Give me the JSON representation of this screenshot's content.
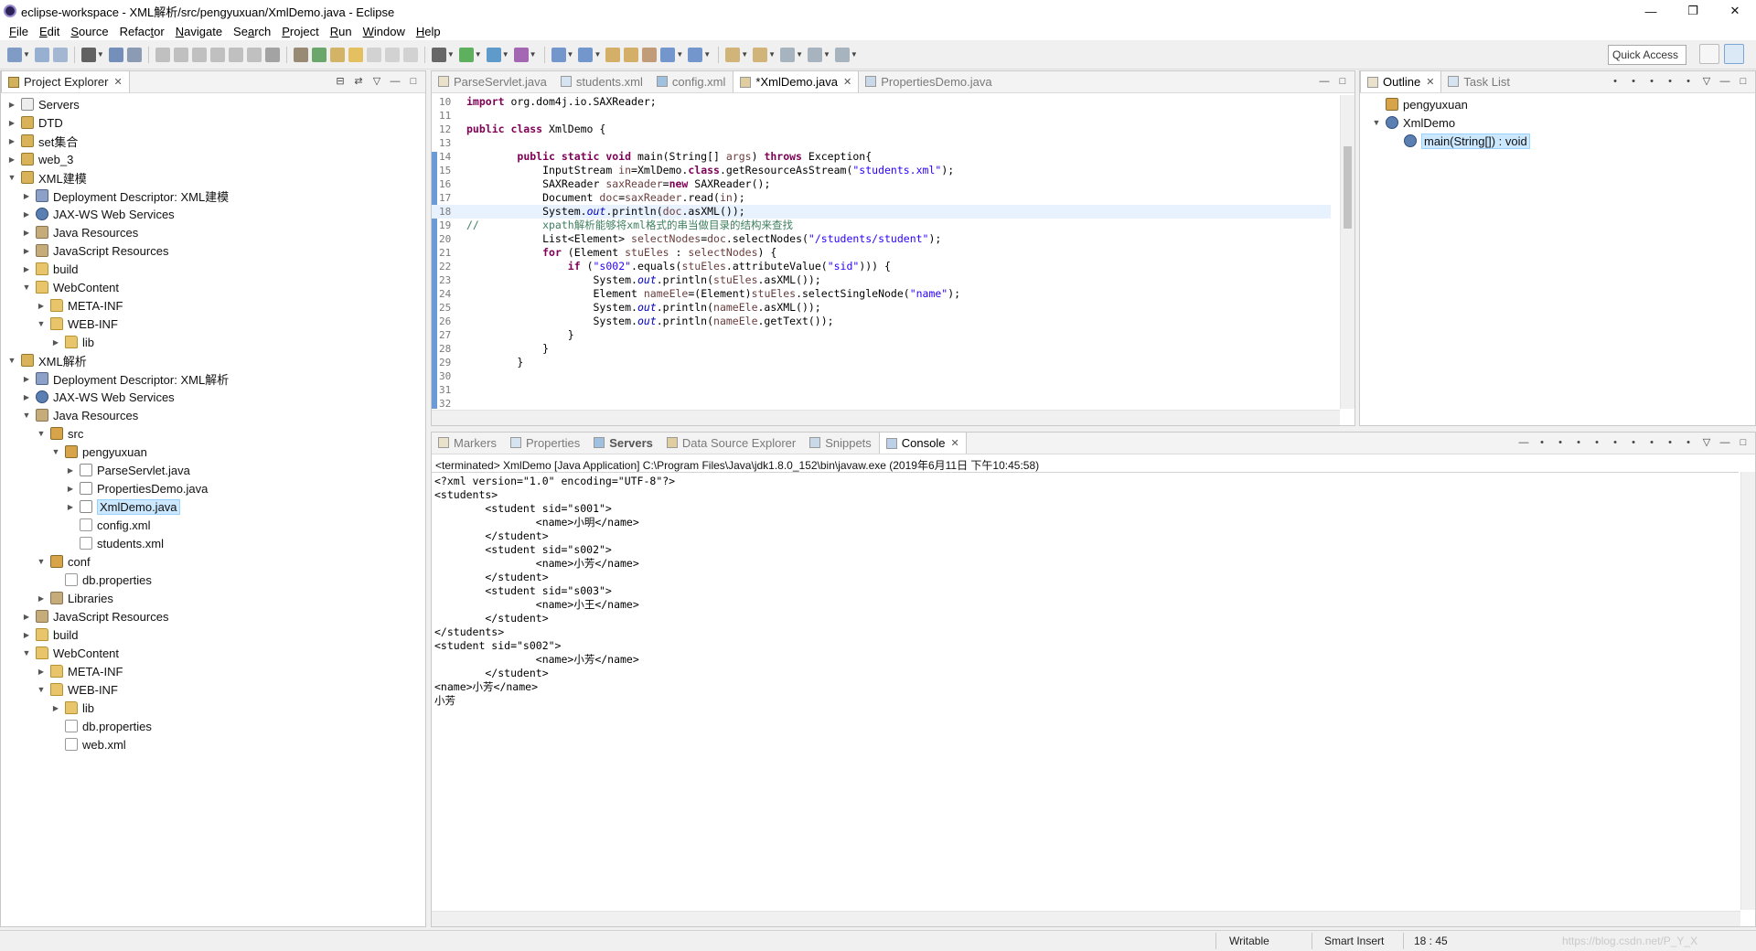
{
  "window": {
    "title": "eclipse-workspace - XML解析/src/pengyuxuan/XmlDemo.java - Eclipse"
  },
  "menu": [
    {
      "pre": "",
      "u": "F",
      "post": "ile"
    },
    {
      "pre": "",
      "u": "E",
      "post": "dit"
    },
    {
      "pre": "",
      "u": "S",
      "post": "ource"
    },
    {
      "pre": "Refac",
      "u": "t",
      "post": "or"
    },
    {
      "pre": "",
      "u": "N",
      "post": "avigate"
    },
    {
      "pre": "Se",
      "u": "a",
      "post": "rch"
    },
    {
      "pre": "",
      "u": "P",
      "post": "roject"
    },
    {
      "pre": "",
      "u": "R",
      "post": "un"
    },
    {
      "pre": "",
      "u": "W",
      "post": "indow"
    },
    {
      "pre": "",
      "u": "H",
      "post": "elp"
    }
  ],
  "toolbar": {
    "quick_access": "Quick Access"
  },
  "project_explorer": {
    "tab": "Project Explorer",
    "items": [
      {
        "label": "Servers",
        "depth": 0,
        "arrow": "right",
        "icon": "srv"
      },
      {
        "label": "DTD",
        "depth": 0,
        "arrow": "right",
        "icon": "proj"
      },
      {
        "label": "set集合",
        "depth": 0,
        "arrow": "right",
        "icon": "proj"
      },
      {
        "label": "web_3",
        "depth": 0,
        "arrow": "right",
        "icon": "proj"
      },
      {
        "label": "XML建模",
        "depth": 0,
        "arrow": "down",
        "icon": "proj"
      },
      {
        "label": "Deployment Descriptor: XML建模",
        "depth": 1,
        "arrow": "right",
        "icon": "dd"
      },
      {
        "label": "JAX-WS Web Services",
        "depth": 1,
        "arrow": "right",
        "icon": "ws"
      },
      {
        "label": "Java Resources",
        "depth": 1,
        "arrow": "right",
        "icon": "lib"
      },
      {
        "label": "JavaScript Resources",
        "depth": 1,
        "arrow": "right",
        "icon": "lib"
      },
      {
        "label": "build",
        "depth": 1,
        "arrow": "right",
        "icon": "folder"
      },
      {
        "label": "WebContent",
        "depth": 1,
        "arrow": "down",
        "icon": "folder"
      },
      {
        "label": "META-INF",
        "depth": 2,
        "arrow": "right",
        "icon": "folder"
      },
      {
        "label": "WEB-INF",
        "depth": 2,
        "arrow": "down",
        "icon": "folder"
      },
      {
        "label": "lib",
        "depth": 3,
        "arrow": "right",
        "icon": "folder"
      },
      {
        "label": "XML解析",
        "depth": 0,
        "arrow": "down",
        "icon": "proj"
      },
      {
        "label": "Deployment Descriptor: XML解析",
        "depth": 1,
        "arrow": "right",
        "icon": "dd"
      },
      {
        "label": "JAX-WS Web Services",
        "depth": 1,
        "arrow": "right",
        "icon": "ws"
      },
      {
        "label": "Java Resources",
        "depth": 1,
        "arrow": "down",
        "icon": "lib"
      },
      {
        "label": "src",
        "depth": 2,
        "arrow": "down",
        "icon": "pkg"
      },
      {
        "label": "pengyuxuan",
        "depth": 3,
        "arrow": "down",
        "icon": "pkg"
      },
      {
        "label": "ParseServlet.java",
        "depth": 4,
        "arrow": "right",
        "icon": "java"
      },
      {
        "label": "PropertiesDemo.java",
        "depth": 4,
        "arrow": "right",
        "icon": "java"
      },
      {
        "label": "XmlDemo.java",
        "depth": 4,
        "arrow": "right",
        "icon": "java",
        "selected": true
      },
      {
        "label": "config.xml",
        "depth": 4,
        "arrow": "",
        "icon": "xml"
      },
      {
        "label": "students.xml",
        "depth": 4,
        "arrow": "",
        "icon": "xml"
      },
      {
        "label": "conf",
        "depth": 2,
        "arrow": "down",
        "icon": "pkg"
      },
      {
        "label": "db.properties",
        "depth": 3,
        "arrow": "",
        "icon": "xml"
      },
      {
        "label": "Libraries",
        "depth": 2,
        "arrow": "right",
        "icon": "lib"
      },
      {
        "label": "JavaScript Resources",
        "depth": 1,
        "arrow": "right",
        "icon": "lib"
      },
      {
        "label": "build",
        "depth": 1,
        "arrow": "right",
        "icon": "folder"
      },
      {
        "label": "WebContent",
        "depth": 1,
        "arrow": "down",
        "icon": "folder"
      },
      {
        "label": "META-INF",
        "depth": 2,
        "arrow": "right",
        "icon": "folder"
      },
      {
        "label": "WEB-INF",
        "depth": 2,
        "arrow": "down",
        "icon": "folder"
      },
      {
        "label": "lib",
        "depth": 3,
        "arrow": "right",
        "icon": "folder"
      },
      {
        "label": "db.properties",
        "depth": 3,
        "arrow": "",
        "icon": "xml"
      },
      {
        "label": "web.xml",
        "depth": 3,
        "arrow": "",
        "icon": "xml"
      }
    ]
  },
  "editor": {
    "tabs": [
      {
        "label": "ParseServlet.java",
        "active": false
      },
      {
        "label": "students.xml",
        "active": false
      },
      {
        "label": "config.xml",
        "active": false
      },
      {
        "label": "*XmlDemo.java",
        "active": true
      },
      {
        "label": "PropertiesDemo.java",
        "active": false
      }
    ],
    "lines": [
      {
        "n": "10",
        "html": "<span class=\"kw\">import</span> org.dom4j.io.SAXReader;"
      },
      {
        "n": "11",
        "html": ""
      },
      {
        "n": "12",
        "html": "<span class=\"kw\">public class</span> XmlDemo {"
      },
      {
        "n": "13",
        "html": ""
      },
      {
        "n": "14",
        "html": "        <span class=\"kw\">public static void</span> main(String[] <span class=\"var\">args</span>) <span class=\"kw\">throws</span> Exception{"
      },
      {
        "n": "15",
        "html": "            InputStream <span class=\"var\">in</span>=XmlDemo.<span class=\"kw\">class</span>.getResourceAsStream(<span class=\"st\">\"students.xml\"</span>);"
      },
      {
        "n": "16",
        "html": "            SAXReader <span class=\"var\">saxReader</span>=<span class=\"kw\">new</span> SAXReader();"
      },
      {
        "n": "17",
        "html": "            Document <span class=\"var\">doc</span>=<span class=\"var\">saxReader</span>.read(<span class=\"var\">in</span>);"
      },
      {
        "n": "18",
        "html": "            System.<span class=\"fld\">out</span>.println(<span class=\"var\">doc</span>.asXML());",
        "cur": true
      },
      {
        "n": "19",
        "html": "<span class=\"cm\">//          xpath解析能够将xml格式的串当做目录的结构来查找</span>"
      },
      {
        "n": "20",
        "html": "            List&lt;Element&gt; <span class=\"var\">selectNodes</span>=<span class=\"var\">doc</span>.selectNodes(<span class=\"st\">\"/students/student\"</span>);"
      },
      {
        "n": "21",
        "html": "            <span class=\"kw\">for</span> (Element <span class=\"var\">stuEles</span> : <span class=\"var\">selectNodes</span>) {"
      },
      {
        "n": "22",
        "html": "                <span class=\"kw\">if</span> (<span class=\"st\">\"s002\"</span>.equals(<span class=\"var\">stuEles</span>.attributeValue(<span class=\"st\">\"sid\"</span>))) {"
      },
      {
        "n": "23",
        "html": "                    System.<span class=\"fld\">out</span>.println(<span class=\"var\">stuEles</span>.asXML());"
      },
      {
        "n": "24",
        "html": "                    Element <span class=\"var\">nameEle</span>=(Element)<span class=\"var\">stuEles</span>.selectSingleNode(<span class=\"st\">\"name\"</span>);"
      },
      {
        "n": "25",
        "html": "                    System.<span class=\"fld\">out</span>.println(<span class=\"var\">nameEle</span>.asXML());"
      },
      {
        "n": "26",
        "html": "                    System.<span class=\"fld\">out</span>.println(<span class=\"var\">nameEle</span>.getText());"
      },
      {
        "n": "27",
        "html": "                }"
      },
      {
        "n": "28",
        "html": "            }"
      },
      {
        "n": "29",
        "html": "        }"
      },
      {
        "n": "30",
        "html": ""
      },
      {
        "n": "31",
        "html": ""
      },
      {
        "n": "32",
        "html": ""
      }
    ]
  },
  "outline": {
    "tabs": [
      {
        "label": "Outline",
        "active": true
      },
      {
        "label": "Task List",
        "active": false
      }
    ],
    "items": [
      {
        "label": "pengyuxuan",
        "depth": 0,
        "arrow": "",
        "icon": "pkg"
      },
      {
        "label": "XmlDemo",
        "depth": 0,
        "arrow": "down",
        "icon": "ws"
      },
      {
        "label": "main(String[]) : void",
        "depth": 1,
        "arrow": "",
        "icon": "ws",
        "selected": true
      }
    ]
  },
  "bottom": {
    "tabs": [
      {
        "label": "Markers",
        "active": false
      },
      {
        "label": "Properties",
        "active": false
      },
      {
        "label": "Servers",
        "active": false,
        "bold": true
      },
      {
        "label": "Data Source Explorer",
        "active": false
      },
      {
        "label": "Snippets",
        "active": false
      },
      {
        "label": "Console",
        "active": true
      }
    ],
    "console_info": "<terminated> XmlDemo [Java Application] C:\\Program Files\\Java\\jdk1.8.0_152\\bin\\javaw.exe (2019年6月11日 下午10:45:58)",
    "output": [
      "<?xml version=\"1.0\" encoding=\"UTF-8\"?>",
      "<students>",
      "        <student sid=\"s001\">",
      "                <name>小明</name>",
      "        </student>",
      "        <student sid=\"s002\">",
      "                <name>小芳</name>",
      "        </student>",
      "        <student sid=\"s003\">",
      "                <name>小王</name>",
      "        </student>",
      "</students>",
      "<student sid=\"s002\">",
      "                <name>小芳</name>",
      "        </student>",
      "<name>小芳</name>",
      "小芳"
    ]
  },
  "status": {
    "writable": "Writable",
    "insert_mode": "Smart Insert",
    "position": "18 : 45",
    "watermark": "https://blog.csdn.net/P_Y_X"
  }
}
